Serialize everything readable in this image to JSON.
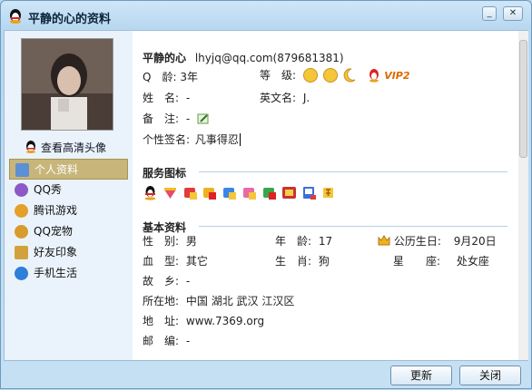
{
  "window": {
    "title": "平静的心的资料"
  },
  "sidebar": {
    "hd_link": "查看高清头像",
    "items": [
      {
        "label": "个人资料",
        "icon": "profile-card-icon",
        "color": "#5c8fd6",
        "active": true
      },
      {
        "label": "QQ秀",
        "icon": "qq-show-icon",
        "color": "#8b5ac7"
      },
      {
        "label": "腾讯游戏",
        "icon": "tencent-games-icon",
        "color": "#e3a12a"
      },
      {
        "label": "QQ宠物",
        "icon": "qq-pet-icon",
        "color": "#d89b2d"
      },
      {
        "label": "好友印象",
        "icon": "friend-impression-icon",
        "color": "#d1a23c"
      },
      {
        "label": "手机生活",
        "icon": "mobile-life-icon",
        "color": "#2d7fd8"
      }
    ]
  },
  "profile": {
    "name": "平静的心",
    "email_qq": "lhyjq@qq.com(879681381)",
    "q_age_label": "Q　龄:",
    "q_age_value": "3年",
    "level_label": "等　级:",
    "vip_label": "VIP2",
    "surname_label": "姓　名:",
    "surname_value": "-",
    "english_name_label": "英文名:",
    "english_name_value": "J.",
    "remark_label": "备　注:",
    "remark_value": "-",
    "signature_label": "个性签名:",
    "signature_value": "凡事得忍"
  },
  "services": {
    "title": "服务图标"
  },
  "basic": {
    "title": "基本资料",
    "gender_label": "性　别:",
    "gender_value": "男",
    "age_label": "年　龄:",
    "age_value": "17",
    "birthday_label": "公历生日:",
    "birthday_value": "9月20日",
    "blood_label": "血　型:",
    "blood_value": "其它",
    "zodiac_label": "生　肖:",
    "zodiac_value": "狗",
    "constellation_label": "星　　座:",
    "constellation_value": "处女座",
    "hometown_label": "故　乡:",
    "hometown_value": "-",
    "location_label": "所在地:",
    "location_value": "中国 湖北 武汉 江汉区",
    "address_label": "地　址:",
    "address_value": "www.7369.org",
    "postcode_label": "邮　编:",
    "postcode_value": "-"
  },
  "footer": {
    "refresh": "更新",
    "close": "关闭"
  }
}
